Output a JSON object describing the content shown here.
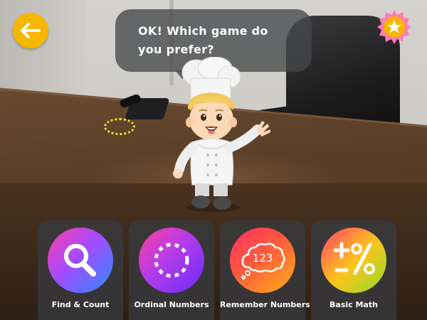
{
  "header": {
    "back_icon": "arrow-left-icon",
    "star_icon": "star-badge-icon",
    "accent_color": "#f7b600",
    "badge_color": "#ff7ab8"
  },
  "dialog": {
    "text": "OK! Which game do you prefer?"
  },
  "character": {
    "icon": "chef-character"
  },
  "games": [
    {
      "label": "Find & Count",
      "icon": "magnifier-icon"
    },
    {
      "label": "Ordinal Numbers",
      "icon": "dotted-circle-icon"
    },
    {
      "label": "Remember Numbers",
      "icon": "thought-bubble-123-icon",
      "icon_text": "123"
    },
    {
      "label": "Basic Math",
      "icon": "plus-minus-percent-icon"
    }
  ]
}
